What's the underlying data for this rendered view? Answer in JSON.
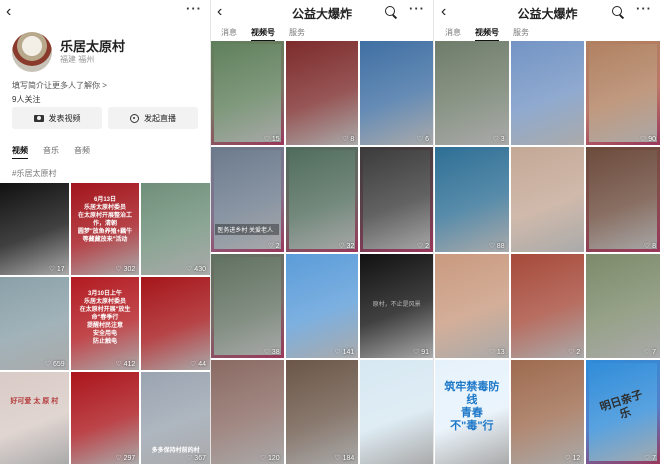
{
  "screen1": {
    "back_icon": "chevron-left-icon",
    "more_icon": "more-dots-icon",
    "account_name": "乐居太原村",
    "location": "福建 福州",
    "intro_prompt": "填写简介让更多人了解你 >",
    "followers": "9人关注",
    "publish_button": "发表视频",
    "live_button": "发起直播",
    "tabs": [
      {
        "label": "视频",
        "active": true
      },
      {
        "label": "音乐",
        "active": false
      },
      {
        "label": "音频",
        "active": false
      }
    ],
    "hashtag": "#乐居太原村",
    "videos": [
      {
        "likes": "17",
        "bg": "#111111"
      },
      {
        "likes": "302",
        "bg": "#a3141b",
        "text": "6月13日\n乐居太原村委员\n在太原村开展整治工作，清朝\n圆梦\"放鱼养殖+藕牛等藏藏放来\"活动"
      },
      {
        "likes": "430",
        "bg": "#6f8f7a"
      },
      {
        "likes": "659",
        "bg": "#8aa0a8"
      },
      {
        "likes": "412",
        "bg": "#b21a20",
        "text": "3月10日上午\n乐居太原村委员\n在太原村开展\"放生命\"春季行\n提醒村民注意\n安全用电\n防止触电"
      },
      {
        "likes": "44",
        "bg": "#a51519"
      },
      {
        "likes": "",
        "bg": "#d9cbc6",
        "text": "好可爱 太 原 村"
      },
      {
        "likes": "297",
        "bg": "#ab151b"
      },
      {
        "likes": "367",
        "bg": "#9aa4b0",
        "text": "多多保持村前的村"
      }
    ]
  },
  "screen2": {
    "title": "公益大爆炸",
    "search_icon": "search-icon",
    "tabs": [
      {
        "label": "消息",
        "active": false
      },
      {
        "label": "视频号",
        "active": true
      },
      {
        "label": "服务",
        "active": false
      }
    ],
    "videos": [
      {
        "likes": "15",
        "bg": "#5f7f5b",
        "highlight": true
      },
      {
        "likes": "8",
        "bg": "#7d2b2b"
      },
      {
        "likes": "6",
        "bg": "#3f6fa3"
      },
      {
        "likes": "2",
        "bg": "#6b7a8c",
        "highlight": true,
        "caption": "医务进乡村  关爱老人"
      },
      {
        "likes": "32",
        "bg": "#4f6b5b",
        "highlight": true
      },
      {
        "likes": "2",
        "bg": "#3b3b3b",
        "highlight": true
      },
      {
        "likes": "38",
        "bg": "#607060",
        "highlight": true
      },
      {
        "likes": "141",
        "bg": "#5b9cd9"
      },
      {
        "likes": "91",
        "bg": "#111111",
        "note": "原村，不止是风景"
      },
      {
        "likes": "120",
        "bg": "#8a6a63"
      },
      {
        "likes": "184",
        "bg": "#6b5648"
      },
      {
        "likes": "",
        "bg": "#d7e8f2"
      }
    ]
  },
  "screen3": {
    "title": "公益大爆炸",
    "search_icon": "search-icon",
    "tabs": [
      {
        "label": "消息",
        "active": false
      },
      {
        "label": "视频号",
        "active": true
      },
      {
        "label": "服务",
        "active": false
      }
    ],
    "videos": [
      {
        "likes": "3",
        "bg": "#6f7c6a"
      },
      {
        "likes": "",
        "bg": "#7394c4"
      },
      {
        "likes": "90",
        "bg": "#b08060",
        "highlight": true
      },
      {
        "likes": "88",
        "bg": "#2e6f95"
      },
      {
        "likes": "",
        "bg": "#c4a896"
      },
      {
        "likes": "8",
        "bg": "#6b4a3b",
        "highlight": true
      },
      {
        "likes": "13",
        "bg": "#c99a7f"
      },
      {
        "likes": "2",
        "bg": "#a64a3a"
      },
      {
        "likes": "7",
        "bg": "#7c8a6a"
      },
      {
        "likes": "",
        "bg": "#e6f2fb",
        "slogan": "筑牢禁毒防线\n青春不\"毒\"行"
      },
      {
        "likes": "12",
        "bg": "#9e6b4f"
      },
      {
        "likes": "7",
        "bg": "#2f8bd8",
        "highlight": true,
        "sign": "明日亲子乐"
      }
    ]
  }
}
